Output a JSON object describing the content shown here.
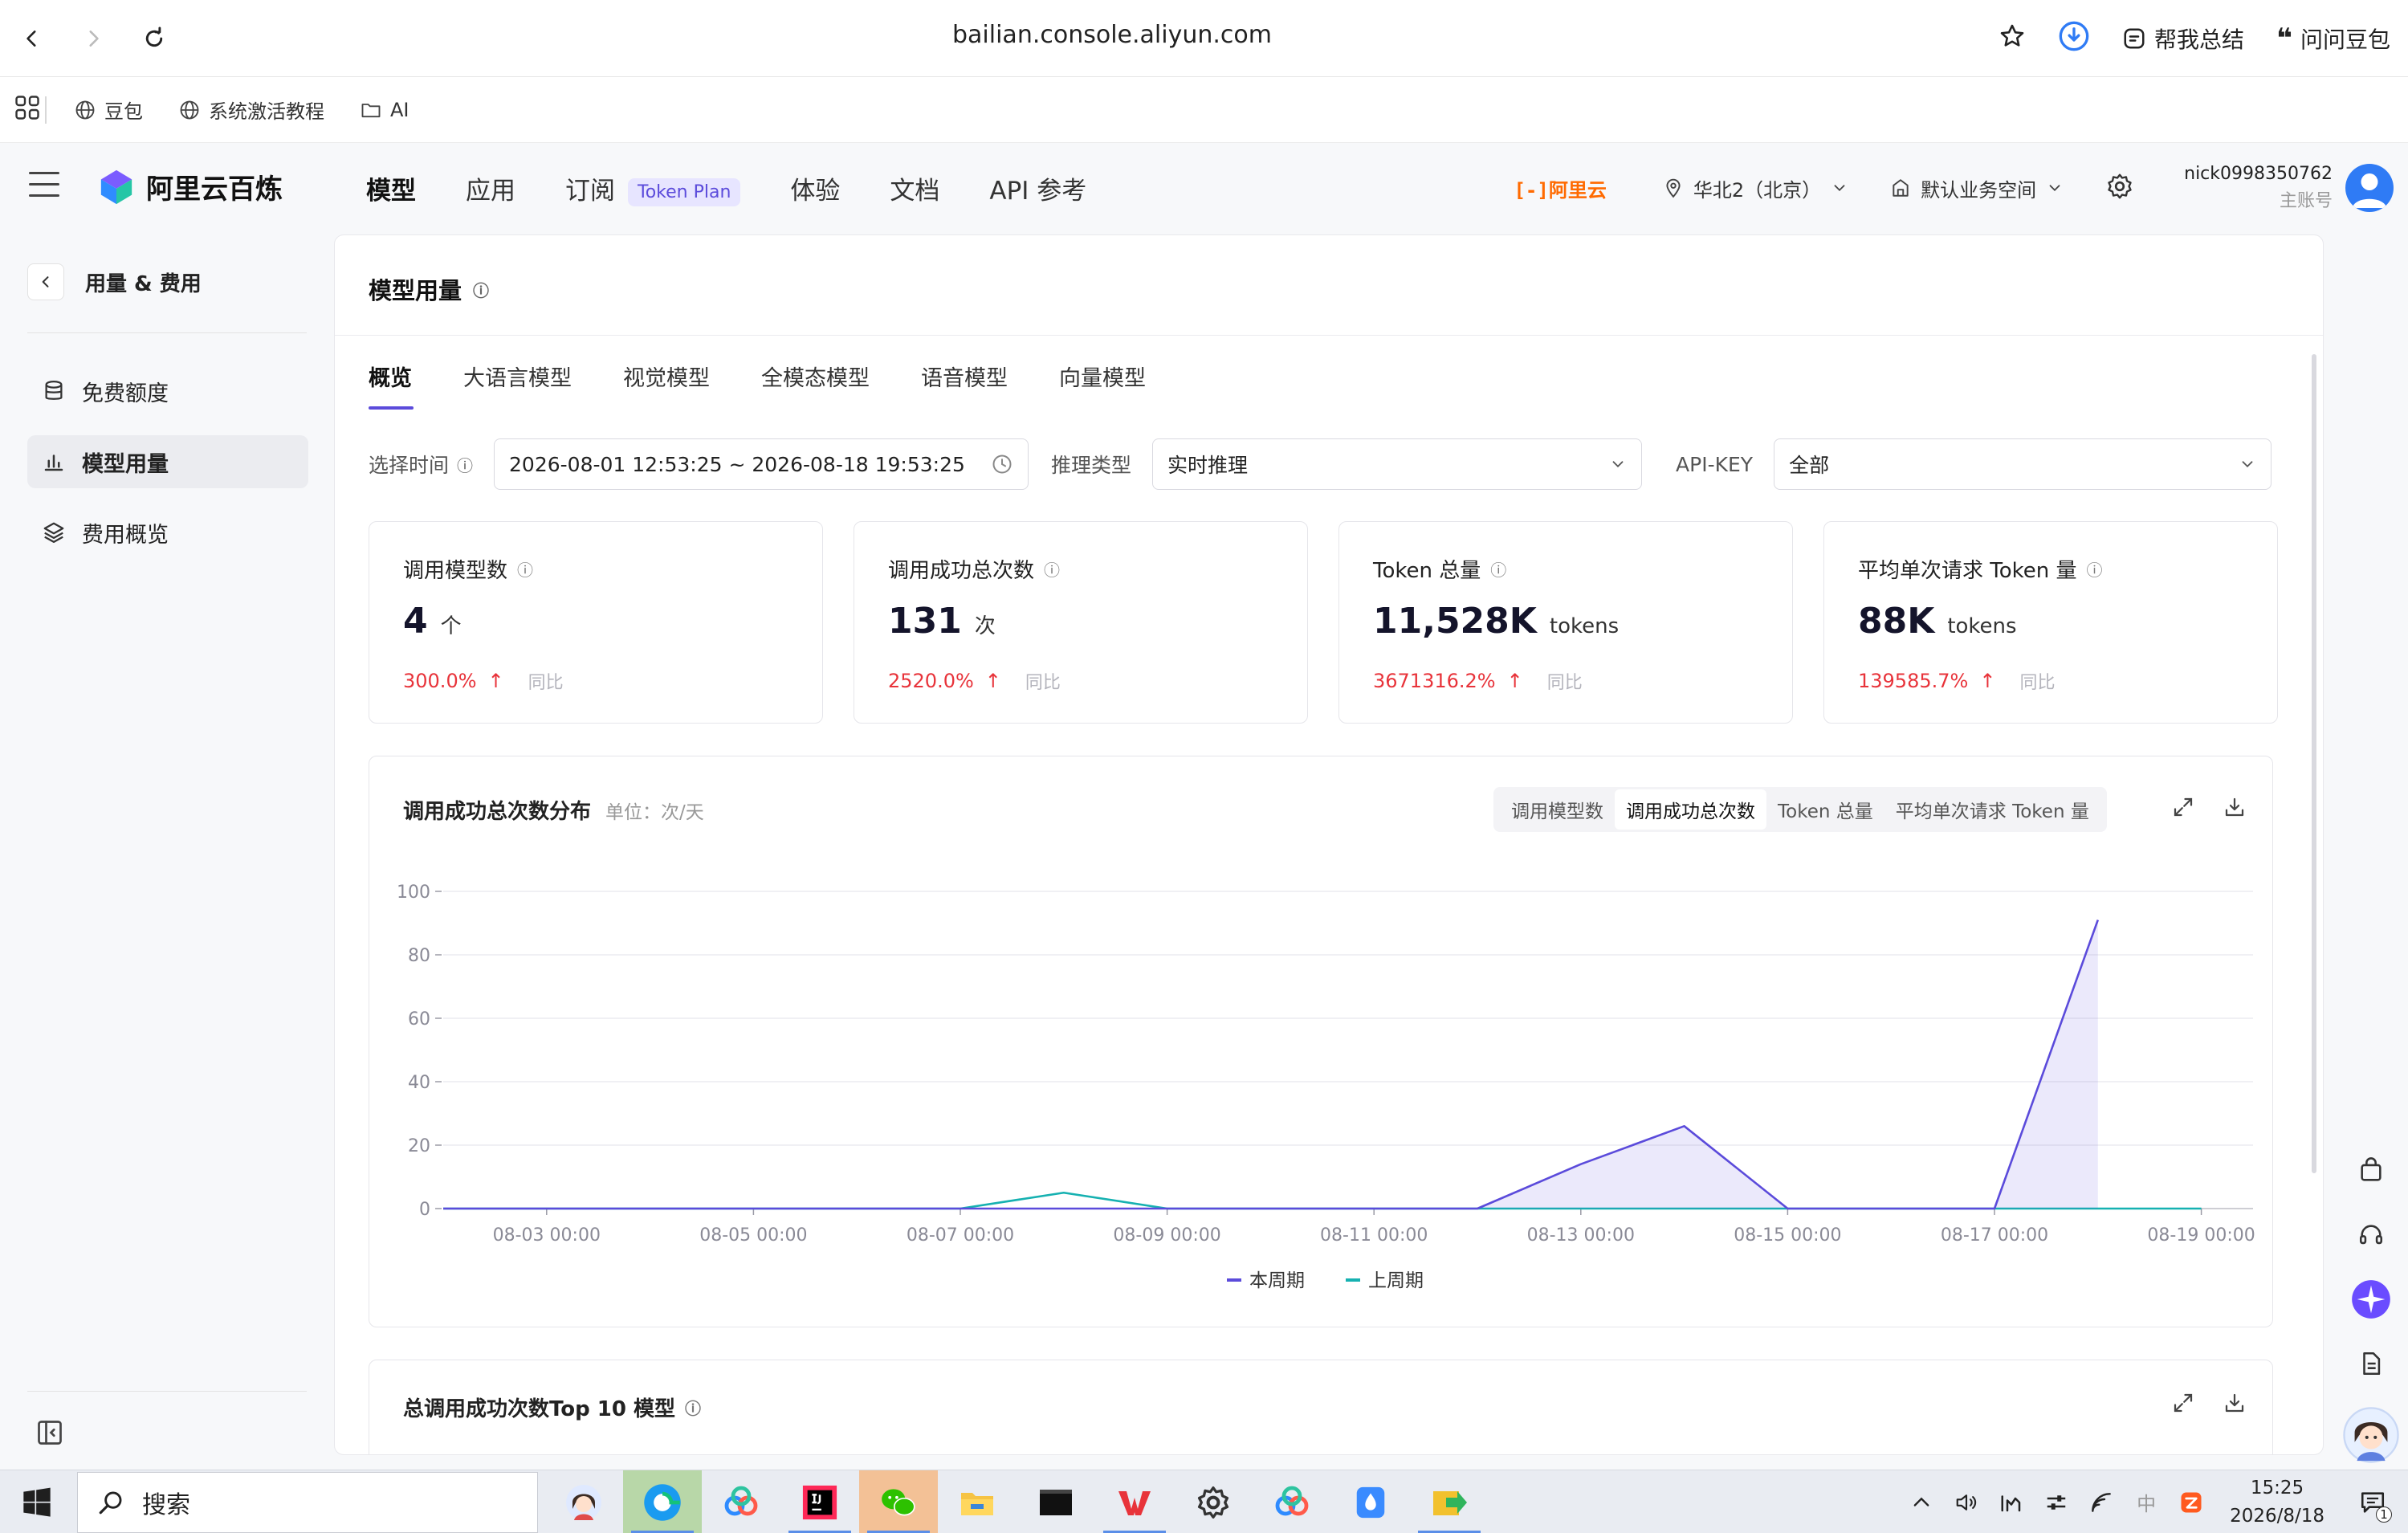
{
  "browser": {
    "url": "bailian.console.aliyun.com",
    "summarize_label": "帮我总结",
    "ask_label": "问问豆包",
    "bookmarks": [
      {
        "label": "豆包",
        "icon": "globe-icon"
      },
      {
        "label": "系统激活教程",
        "icon": "globe-icon"
      },
      {
        "label": "AI",
        "icon": "folder-icon"
      }
    ]
  },
  "header": {
    "brand": "阿里云百炼",
    "nav": [
      {
        "label": "模型",
        "active": true
      },
      {
        "label": "应用"
      },
      {
        "label": "订阅",
        "badge": "Token Plan"
      },
      {
        "label": "体验"
      },
      {
        "label": "文档"
      },
      {
        "label": "API 参考"
      }
    ],
    "aliyun_logo": "阿里云",
    "region": "华北2（北京）",
    "workspace": "默认业务空间",
    "user_name": "nick0998350762",
    "user_role": "主账号"
  },
  "sidebar": {
    "back_title": "用量 & 费用",
    "items": [
      {
        "label": "免费额度",
        "icon": "database-icon"
      },
      {
        "label": "模型用量",
        "icon": "bar-chart-icon",
        "active": true
      },
      {
        "label": "费用概览",
        "icon": "layers-icon"
      }
    ]
  },
  "page": {
    "title": "模型用量",
    "tabs": [
      "概览",
      "大语言模型",
      "视觉模型",
      "全模态模型",
      "语音模型",
      "向量模型"
    ],
    "active_tab": "概览",
    "filters": {
      "time_label": "选择时间",
      "time_value": "2026-08-01 12:53:25 ~ 2026-08-18 19:53:25",
      "infer_label": "推理类型",
      "infer_value": "实时推理",
      "apikey_label": "API-KEY",
      "apikey_value": "全部"
    },
    "stats": [
      {
        "title": "调用模型数",
        "value": "4",
        "unit": "个",
        "change": "300.0%",
        "compare": "同比"
      },
      {
        "title": "调用成功总次数",
        "value": "131",
        "unit": "次",
        "change": "2520.0%",
        "compare": "同比"
      },
      {
        "title": "Token 总量",
        "value": "11,528K",
        "unit": "tokens",
        "change": "3671316.2%",
        "compare": "同比"
      },
      {
        "title": "平均单次请求 Token 量",
        "value": "88K",
        "unit": "tokens",
        "change": "139585.7%",
        "compare": "同比"
      }
    ],
    "chart_section": {
      "title": "调用成功总次数分布",
      "unit": "单位：次/天",
      "metric_tabs": [
        "调用模型数",
        "调用成功总次数",
        "Token 总量",
        "平均单次请求 Token 量"
      ],
      "active_metric": "调用成功总次数"
    },
    "top10_title": "总调用成功次数Top 10 模型"
  },
  "chart_data": {
    "type": "line",
    "ylim": [
      0,
      100
    ],
    "yticks": [
      0,
      20,
      40,
      60,
      80,
      100
    ],
    "xlim": [
      "2026-08-02",
      "2026-08-19 12:00"
    ],
    "xticks": [
      "08-03 00:00",
      "08-05 00:00",
      "08-07 00:00",
      "08-09 00:00",
      "08-11 00:00",
      "08-13 00:00",
      "08-15 00:00",
      "08-17 00:00",
      "08-19 00:00"
    ],
    "x": [
      "2026-08-02",
      "2026-08-03",
      "2026-08-04",
      "2026-08-05",
      "2026-08-06",
      "2026-08-07",
      "2026-08-08",
      "2026-08-09",
      "2026-08-10",
      "2026-08-11",
      "2026-08-12",
      "2026-08-13",
      "2026-08-14",
      "2026-08-15",
      "2026-08-16",
      "2026-08-17",
      "2026-08-18",
      "2026-08-19"
    ],
    "series": [
      {
        "name": "本周期",
        "color": "#5b4bdb",
        "area": true,
        "values": [
          0,
          0,
          0,
          0,
          0,
          0,
          0,
          0,
          0,
          0,
          0,
          14,
          26,
          0,
          0,
          0,
          91,
          null
        ]
      },
      {
        "name": "上周期",
        "color": "#16b1b1",
        "area": false,
        "values": [
          0,
          0,
          0,
          0,
          0,
          0,
          5,
          0,
          0,
          0,
          0,
          0,
          0,
          0,
          0,
          0,
          0,
          0
        ]
      }
    ],
    "legend": "bottom-center",
    "grid": true
  },
  "taskbar": {
    "search_placeholder": "搜索",
    "time": "15:25",
    "date": "2026/8/18",
    "ime": "中",
    "notification_count": "1"
  },
  "colors": {
    "accent": "#5b4bdb",
    "increase": "#e8333a",
    "aliyun_orange": "#ff6a00"
  }
}
